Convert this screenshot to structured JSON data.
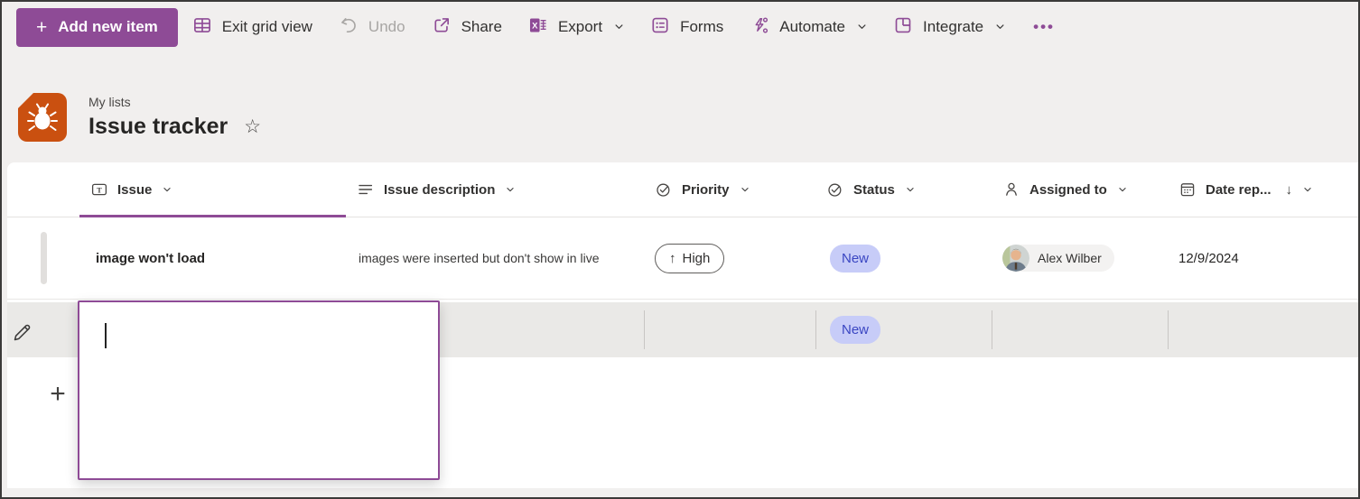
{
  "colors": {
    "accent_purple": "#8e4b96",
    "status_new_bg": "#c7ccf8",
    "status_new_text": "#3a46c2",
    "list_icon_bg": "#ca5010",
    "toolbar_bg": "#f1efee"
  },
  "icons": {
    "plus": "+",
    "star": "☆",
    "sort_descending": "↓",
    "priority_up": "↑",
    "more": "•••"
  },
  "toolbar": {
    "add_new_item_label": "Add new item",
    "items": [
      {
        "label": "Exit grid view",
        "icon": "grid-icon",
        "disabled": false,
        "has_chevron": false
      },
      {
        "label": "Undo",
        "icon": "undo-icon",
        "disabled": true,
        "has_chevron": false
      },
      {
        "label": "Share",
        "icon": "share-icon",
        "disabled": false,
        "has_chevron": false
      },
      {
        "label": "Export",
        "icon": "excel-icon",
        "disabled": false,
        "has_chevron": true
      },
      {
        "label": "Forms",
        "icon": "forms-icon",
        "disabled": false,
        "has_chevron": false
      },
      {
        "label": "Automate",
        "icon": "automate-icon",
        "disabled": false,
        "has_chevron": true
      },
      {
        "label": "Integrate",
        "icon": "integrate-icon",
        "disabled": false,
        "has_chevron": true
      }
    ]
  },
  "list_header": {
    "breadcrumb": "My lists",
    "title": "Issue tracker"
  },
  "table": {
    "columns": [
      {
        "label": "Issue",
        "icon": "single-line-text-icon"
      },
      {
        "label": "Issue description",
        "icon": "multiline-text-icon"
      },
      {
        "label": "Priority",
        "icon": "choice-icon"
      },
      {
        "label": "Status",
        "icon": "choice-icon"
      },
      {
        "label": "Assigned to",
        "icon": "person-icon"
      },
      {
        "label": "Date rep...",
        "icon": "date-icon",
        "sort": "descending"
      }
    ],
    "rows": [
      {
        "issue": "image won't load",
        "description": "images were inserted but don't show in live",
        "priority": "High",
        "status": "New",
        "assigned_to": "Alex Wilber",
        "date_reported": "12/9/2024"
      }
    ],
    "new_row": {
      "status": "New",
      "editing_value": ""
    }
  }
}
